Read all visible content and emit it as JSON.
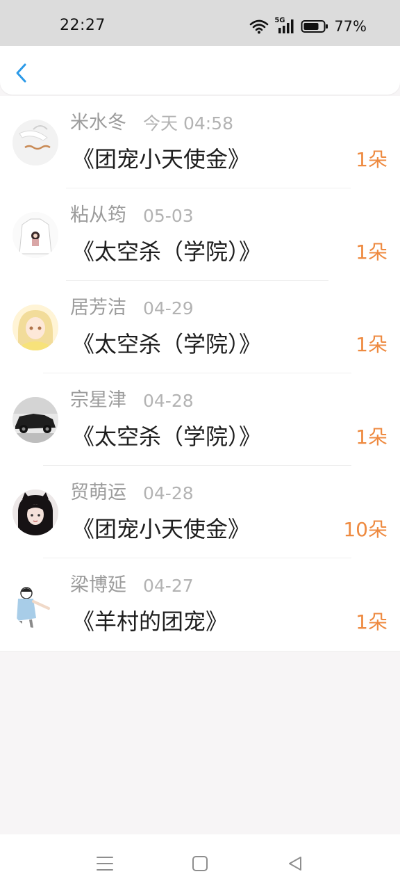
{
  "status_bar": {
    "time": "22:27",
    "network": "5G",
    "battery": "77%",
    "icons": [
      "wifi-icon",
      "signal-5g-icon",
      "battery-icon"
    ]
  },
  "header": {
    "back_icon": "chevron-left-icon",
    "accent_color": "#2b9ae8"
  },
  "records": [
    {
      "user": "米水冬",
      "date": "今天 04:58",
      "book": "《团宠小天使金》",
      "count": "1朵"
    },
    {
      "user": "粘从筠",
      "date": "05-03",
      "book": "《太空杀（学院）》",
      "count": "1朵"
    },
    {
      "user": "居芳洁",
      "date": "04-29",
      "book": "《太空杀（学院）》",
      "count": "1朵"
    },
    {
      "user": "宗星津",
      "date": "04-28",
      "book": "《太空杀（学院）》",
      "count": "1朵"
    },
    {
      "user": "贸萌运",
      "date": "04-28",
      "book": "《团宠小天使金》",
      "count": "10朵"
    },
    {
      "user": "梁博延",
      "date": "04-27",
      "book": "《羊村的团宠》",
      "count": "1朵"
    }
  ],
  "colors": {
    "count": "#ee8a40",
    "name": "#9c9c9c",
    "title": "#1e1e1e"
  },
  "nav_bar": {
    "icons": [
      "menu-icon",
      "home-square-icon",
      "back-triangle-icon"
    ]
  }
}
